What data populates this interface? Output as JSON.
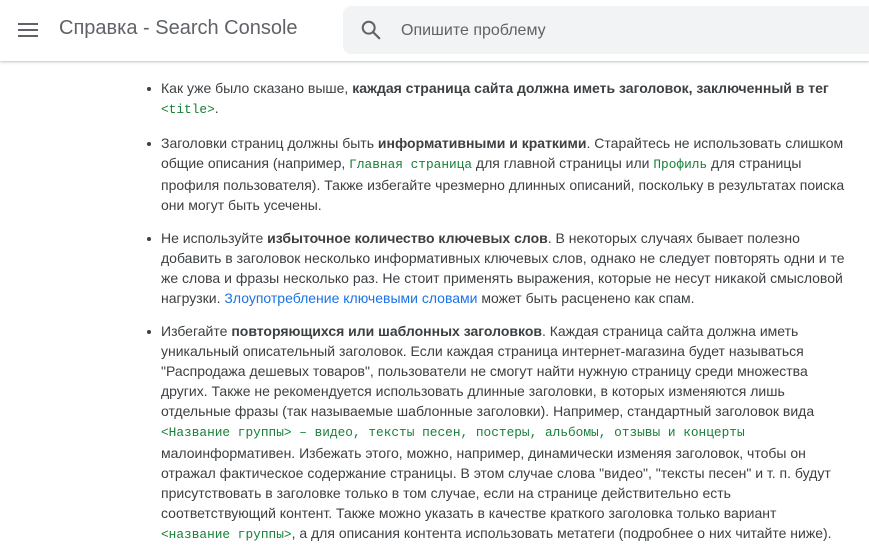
{
  "header": {
    "title": "Справка - Search Console",
    "menu_icon": "menu-icon",
    "search": {
      "icon": "search-icon",
      "placeholder": "Опишите проблему",
      "value": ""
    }
  },
  "article": {
    "items": [
      {
        "t1": "Как уже было сказано выше, ",
        "b1": "каждая страница сайта должна иметь заголовок, заключенный в тег",
        "t2": " ",
        "code1": "<title>",
        "t3": "."
      },
      {
        "t1": "Заголовки страниц должны быть ",
        "b1": "информативными и краткими",
        "t2": ". Старайтесь не использовать слишком общие описания (например, ",
        "code1": "Главная страница",
        "t3": " для главной страницы или ",
        "code2": "Профиль",
        "t4": " для страницы профиля пользователя). Также избегайте чрезмерно длинных описаний, поскольку в результатах поиска они могут быть усечены."
      },
      {
        "t1": "Не используйте ",
        "b1": "избыточное количество ключевых слов",
        "t2": ". В некоторых случаях бывает полезно добавить в заголовок несколько информативных ключевых слов, однако не следует повторять одни и те же слова и фразы несколько раз. Не стоит применять выражения, которые не несут никакой смысловой нагрузки. ",
        "link1": "Злоупотребление ключевыми словами",
        "t3": " может быть расценено как спам."
      },
      {
        "t1": "Избегайте ",
        "b1": "повторяющихся или шаблонных заголовков",
        "t2": ". Каждая страница сайта должна иметь уникальный описательный заголовок. Если каждая страница интернет-магазина будет называться \"Распродажа дешевых товаров\", пользователи не смогут найти нужную страницу среди множества других. Также не рекомендуется использовать длинные заголовки, в которых изменяются лишь отдельные фразы (так называемые шаблонные заголовки). Например, стандартный заголовок вида ",
        "code1": "<Название группы> – видео, тексты песен, постеры, альбомы, отзывы и концерты",
        "t3": " малоинформативен. Избежать этого, можно, например, динамически изменяя заголовок, чтобы он отражал фактическое содержание страницы. В этом случае слова \"видео\", \"тексты песен\" и т. п. будут присутствовать в заголовке только в том случае, если на странице действительно есть соответствующий контент. Также можно указать в качестве краткого заголовка только вариант ",
        "code2": "<название группы>",
        "t4": ", а для описания контента использовать метатеги (подробнее о них читайте ниже)."
      }
    ]
  },
  "colors": {
    "code": "#188038",
    "link": "#1a73e8",
    "text": "#3c4043",
    "search_bg": "#f1f3f4"
  }
}
